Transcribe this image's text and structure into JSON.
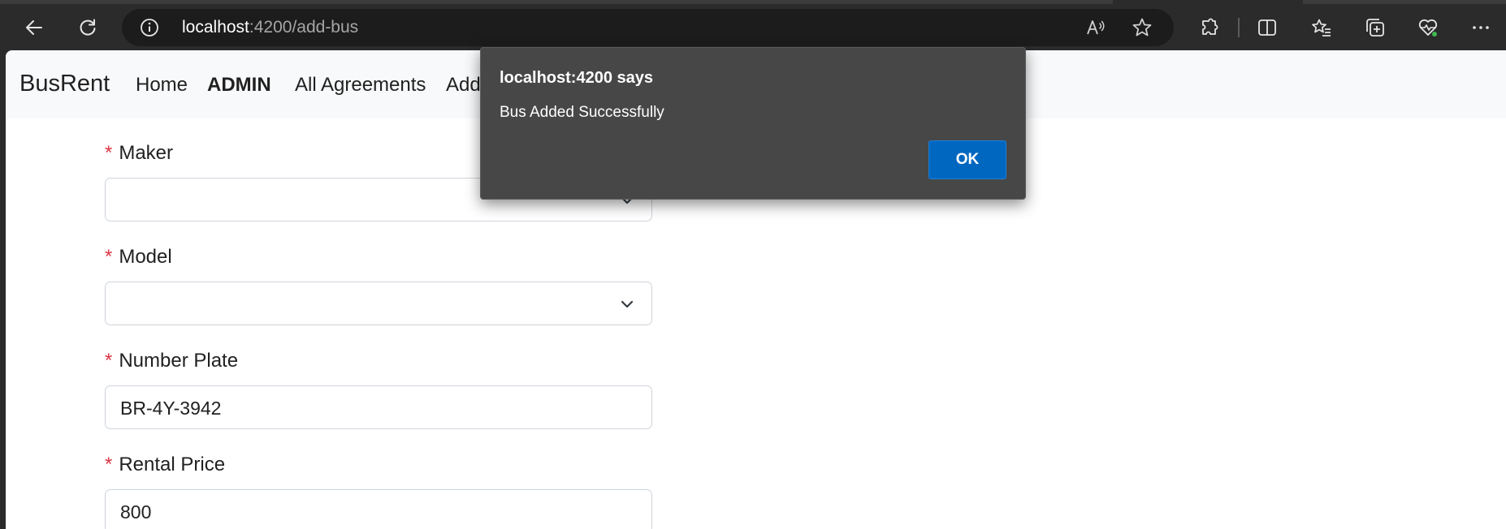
{
  "browser": {
    "url_host": "localhost",
    "url_path": ":4200/add-bus"
  },
  "navbar": {
    "brand": "BusRent",
    "links": [
      "Home",
      "ADMIN",
      "All Agreements",
      "Add"
    ]
  },
  "form": {
    "fields": [
      {
        "label": "Maker",
        "required_mark": "*",
        "value": "",
        "type": "select"
      },
      {
        "label": "Model",
        "required_mark": "*",
        "value": "",
        "type": "select"
      },
      {
        "label": "Number Plate",
        "required_mark": "*",
        "value": "BR-4Y-3942",
        "type": "text"
      },
      {
        "label": "Rental Price",
        "required_mark": "*",
        "value": "800",
        "type": "text"
      }
    ]
  },
  "dialog": {
    "title": "localhost:4200 says",
    "message": "Bus Added Successfully",
    "ok_label": "OK"
  },
  "colors": {
    "accent": "#0067c0",
    "required": "#dc3545",
    "chrome": "#2b2b2b"
  }
}
